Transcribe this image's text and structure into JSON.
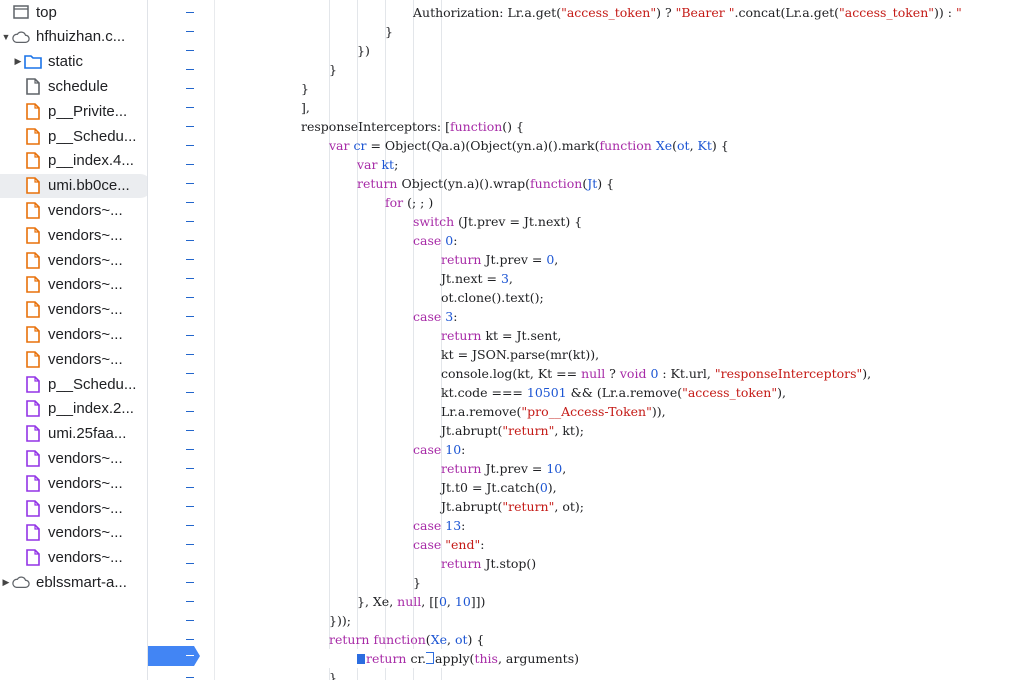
{
  "tree": [
    {
      "label": "top",
      "icon": "frame-icon",
      "indent": 0,
      "arrow": "",
      "color": "#5f6368"
    },
    {
      "label": "hfhuizhan.c...",
      "icon": "cloud-icon",
      "indent": 0,
      "arrow": "down",
      "color": "#5f6368"
    },
    {
      "label": "static",
      "icon": "folder-icon",
      "indent": 1,
      "arrow": "right",
      "color": "#1a73e8"
    },
    {
      "label": "schedule",
      "icon": "file-icon",
      "indent": 1,
      "arrow": "",
      "color": "#5f6368"
    },
    {
      "label": "p__Privite...",
      "icon": "file-icon",
      "indent": 1,
      "arrow": "",
      "color": "#e8710a"
    },
    {
      "label": "p__Schedu...",
      "icon": "file-icon",
      "indent": 1,
      "arrow": "",
      "color": "#e8710a"
    },
    {
      "label": "p__index.4...",
      "icon": "file-icon",
      "indent": 1,
      "arrow": "",
      "color": "#e8710a"
    },
    {
      "label": "umi.bb0ce...",
      "icon": "file-icon",
      "indent": 1,
      "arrow": "",
      "color": "#e8710a",
      "selected": true
    },
    {
      "label": "vendors~...",
      "icon": "file-icon",
      "indent": 1,
      "arrow": "",
      "color": "#e8710a"
    },
    {
      "label": "vendors~...",
      "icon": "file-icon",
      "indent": 1,
      "arrow": "",
      "color": "#e8710a"
    },
    {
      "label": "vendors~...",
      "icon": "file-icon",
      "indent": 1,
      "arrow": "",
      "color": "#e8710a"
    },
    {
      "label": "vendors~...",
      "icon": "file-icon",
      "indent": 1,
      "arrow": "",
      "color": "#e8710a"
    },
    {
      "label": "vendors~...",
      "icon": "file-icon",
      "indent": 1,
      "arrow": "",
      "color": "#e8710a"
    },
    {
      "label": "vendors~...",
      "icon": "file-icon",
      "indent": 1,
      "arrow": "",
      "color": "#e8710a"
    },
    {
      "label": "vendors~...",
      "icon": "file-icon",
      "indent": 1,
      "arrow": "",
      "color": "#e8710a"
    },
    {
      "label": "p__Schedu...",
      "icon": "file-icon",
      "indent": 1,
      "arrow": "",
      "color": "#9334e6"
    },
    {
      "label": "p__index.2...",
      "icon": "file-icon",
      "indent": 1,
      "arrow": "",
      "color": "#9334e6"
    },
    {
      "label": "umi.25faa...",
      "icon": "file-icon",
      "indent": 1,
      "arrow": "",
      "color": "#9334e6"
    },
    {
      "label": "vendors~...",
      "icon": "file-icon",
      "indent": 1,
      "arrow": "",
      "color": "#9334e6"
    },
    {
      "label": "vendors~...",
      "icon": "file-icon",
      "indent": 1,
      "arrow": "",
      "color": "#9334e6"
    },
    {
      "label": "vendors~...",
      "icon": "file-icon",
      "indent": 1,
      "arrow": "",
      "color": "#9334e6"
    },
    {
      "label": "vendors~...",
      "icon": "file-icon",
      "indent": 1,
      "arrow": "",
      "color": "#9334e6"
    },
    {
      "label": "vendors~...",
      "icon": "file-icon",
      "indent": 1,
      "arrow": "",
      "color": "#9334e6"
    },
    {
      "label": "eblssmart-a...",
      "icon": "cloud-icon",
      "indent": 0,
      "arrow": "right",
      "color": "#5f6368"
    }
  ],
  "code_lines": [
    {
      "indent": 7,
      "tokens": [
        [
          "v",
          "Authorization: Lr.a.get("
        ],
        [
          "s",
          "\"access_token\""
        ],
        [
          "v",
          ") ? "
        ],
        [
          "s",
          "\"Bearer \""
        ],
        [
          "v",
          ".concat(Lr.a.get("
        ],
        [
          "s",
          "\"access_token\""
        ],
        [
          "v",
          ")) : "
        ],
        [
          "s",
          "\""
        ]
      ]
    },
    {
      "indent": 6,
      "tokens": [
        [
          "v",
          "}"
        ]
      ]
    },
    {
      "indent": 5,
      "tokens": [
        [
          "v",
          "})"
        ]
      ]
    },
    {
      "indent": 4,
      "tokens": [
        [
          "v",
          "}"
        ]
      ]
    },
    {
      "indent": 3,
      "tokens": [
        [
          "v",
          "}"
        ]
      ]
    },
    {
      "indent": 3,
      "tokens": [
        [
          "v",
          "],"
        ]
      ]
    },
    {
      "indent": 3,
      "tokens": [
        [
          "v",
          "responseInterceptors: ["
        ],
        [
          "k",
          "function"
        ],
        [
          "v",
          "() {"
        ]
      ]
    },
    {
      "indent": 4,
      "tokens": [
        [
          "k",
          "var"
        ],
        [
          "v",
          " "
        ],
        [
          "n",
          "cr"
        ],
        [
          "v",
          " = Object(Qa.a)(Object(yn.a)().mark("
        ],
        [
          "k",
          "function"
        ],
        [
          "v",
          " "
        ],
        [
          "n",
          "Xe"
        ],
        [
          "v",
          "("
        ],
        [
          "n",
          "ot"
        ],
        [
          "v",
          ", "
        ],
        [
          "n",
          "Kt"
        ],
        [
          "v",
          ") {"
        ]
      ]
    },
    {
      "indent": 5,
      "tokens": [
        [
          "k",
          "var"
        ],
        [
          "v",
          " "
        ],
        [
          "n",
          "kt"
        ],
        [
          "v",
          ";"
        ]
      ]
    },
    {
      "indent": 5,
      "tokens": [
        [
          "k",
          "return"
        ],
        [
          "v",
          " Object(yn.a)().wrap("
        ],
        [
          "k",
          "function"
        ],
        [
          "v",
          "("
        ],
        [
          "n",
          "Jt"
        ],
        [
          "v",
          ") {"
        ]
      ]
    },
    {
      "indent": 6,
      "tokens": [
        [
          "k",
          "for"
        ],
        [
          "v",
          " (; ; )"
        ]
      ]
    },
    {
      "indent": 7,
      "tokens": [
        [
          "k",
          "switch"
        ],
        [
          "v",
          " (Jt.prev = Jt.next) {"
        ]
      ]
    },
    {
      "indent": 7,
      "tokens": [
        [
          "k",
          "case"
        ],
        [
          "v",
          " "
        ],
        [
          "n",
          "0"
        ],
        [
          "v",
          ":"
        ]
      ]
    },
    {
      "indent": 8,
      "tokens": [
        [
          "k",
          "return"
        ],
        [
          "v",
          " Jt.prev = "
        ],
        [
          "n",
          "0"
        ],
        [
          "v",
          ","
        ]
      ]
    },
    {
      "indent": 8,
      "tokens": [
        [
          "v",
          "Jt.next = "
        ],
        [
          "n",
          "3"
        ],
        [
          "v",
          ","
        ]
      ]
    },
    {
      "indent": 8,
      "tokens": [
        [
          "v",
          "ot.clone().text();"
        ]
      ]
    },
    {
      "indent": 7,
      "tokens": [
        [
          "k",
          "case"
        ],
        [
          "v",
          " "
        ],
        [
          "n",
          "3"
        ],
        [
          "v",
          ":"
        ]
      ]
    },
    {
      "indent": 8,
      "tokens": [
        [
          "k",
          "return"
        ],
        [
          "v",
          " kt = Jt.sent,"
        ]
      ]
    },
    {
      "indent": 8,
      "tokens": [
        [
          "v",
          "kt = JSON.parse(mr(kt)),"
        ]
      ]
    },
    {
      "indent": 8,
      "tokens": [
        [
          "v",
          "console.log(kt, Kt == "
        ],
        [
          "k",
          "null"
        ],
        [
          "v",
          " ? "
        ],
        [
          "k",
          "void"
        ],
        [
          "v",
          " "
        ],
        [
          "n",
          "0"
        ],
        [
          "v",
          " : Kt.url, "
        ],
        [
          "s",
          "\"responseInterceptors\""
        ],
        [
          "v",
          "),"
        ]
      ]
    },
    {
      "indent": 8,
      "tokens": [
        [
          "v",
          "kt.code === "
        ],
        [
          "n",
          "10501"
        ],
        [
          "v",
          " && (Lr.a.remove("
        ],
        [
          "s",
          "\"access_token\""
        ],
        [
          "v",
          "),"
        ]
      ]
    },
    {
      "indent": 8,
      "tokens": [
        [
          "v",
          "Lr.a.remove("
        ],
        [
          "s",
          "\"pro__Access-Token\""
        ],
        [
          "v",
          ")),"
        ]
      ]
    },
    {
      "indent": 8,
      "tokens": [
        [
          "v",
          "Jt.abrupt("
        ],
        [
          "s",
          "\"return\""
        ],
        [
          "v",
          ", kt);"
        ]
      ]
    },
    {
      "indent": 7,
      "tokens": [
        [
          "k",
          "case"
        ],
        [
          "v",
          " "
        ],
        [
          "n",
          "10"
        ],
        [
          "v",
          ":"
        ]
      ]
    },
    {
      "indent": 8,
      "tokens": [
        [
          "k",
          "return"
        ],
        [
          "v",
          " Jt.prev = "
        ],
        [
          "n",
          "10"
        ],
        [
          "v",
          ","
        ]
      ]
    },
    {
      "indent": 8,
      "tokens": [
        [
          "v",
          "Jt.t0 = Jt.catch("
        ],
        [
          "n",
          "0"
        ],
        [
          "v",
          "),"
        ]
      ]
    },
    {
      "indent": 8,
      "tokens": [
        [
          "v",
          "Jt.abrupt("
        ],
        [
          "s",
          "\"return\""
        ],
        [
          "v",
          ", ot);"
        ]
      ]
    },
    {
      "indent": 7,
      "tokens": [
        [
          "k",
          "case"
        ],
        [
          "v",
          " "
        ],
        [
          "n",
          "13"
        ],
        [
          "v",
          ":"
        ]
      ]
    },
    {
      "indent": 7,
      "tokens": [
        [
          "k",
          "case"
        ],
        [
          "v",
          " "
        ],
        [
          "s",
          "\"end\""
        ],
        [
          "v",
          ":"
        ]
      ]
    },
    {
      "indent": 8,
      "tokens": [
        [
          "k",
          "return"
        ],
        [
          "v",
          " Jt.stop()"
        ]
      ]
    },
    {
      "indent": 7,
      "tokens": [
        [
          "v",
          "}"
        ]
      ]
    },
    {
      "indent": 5,
      "tokens": [
        [
          "v",
          "}, Xe, "
        ],
        [
          "k",
          "null"
        ],
        [
          "v",
          ", [["
        ],
        [
          "n",
          "0"
        ],
        [
          "v",
          ", "
        ],
        [
          "n",
          "10"
        ],
        [
          "v",
          "]])"
        ]
      ]
    },
    {
      "indent": 4,
      "tokens": [
        [
          "v",
          "}));"
        ]
      ]
    },
    {
      "indent": 4,
      "tokens": [
        [
          "k",
          "return"
        ],
        [
          "v",
          " "
        ],
        [
          "k",
          "function"
        ],
        [
          "v",
          "("
        ],
        [
          "n",
          "Xe"
        ],
        [
          "v",
          ", "
        ],
        [
          "n",
          "ot"
        ],
        [
          "v",
          ") {"
        ]
      ]
    },
    {
      "indent": 5,
      "exec": true,
      "tokens": [
        [
          "k",
          "return"
        ],
        [
          "v",
          " cr."
        ],
        [
          "v",
          "apply("
        ],
        [
          "k",
          "this"
        ],
        [
          "v",
          ", arguments)"
        ]
      ]
    },
    {
      "indent": 4,
      "tokens": [
        [
          "v",
          "}"
        ]
      ]
    }
  ],
  "colors": {
    "keyword": "#a72ba7",
    "string": "#c41a16",
    "number": "#1c55d3",
    "breakpoint": "#2b6de0"
  }
}
